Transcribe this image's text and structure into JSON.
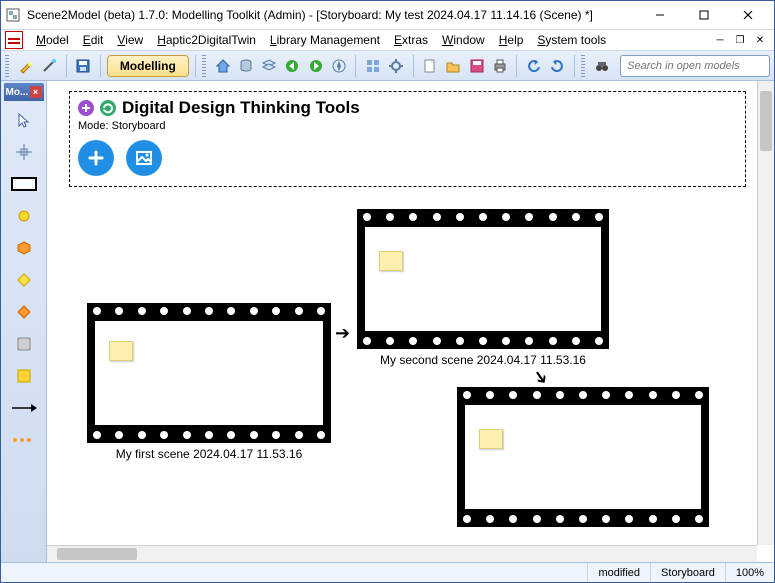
{
  "window": {
    "title": "Scene2Model (beta) 1.7.0: Modelling Toolkit (Admin) - [Storyboard: My test 2024.04.17 11.14.16 (Scene) *]"
  },
  "menu": {
    "items": [
      "Model",
      "Edit",
      "View",
      "Haptic2DigitalTwin",
      "Library Management",
      "Extras",
      "Window",
      "Help",
      "System tools"
    ]
  },
  "mode_pill": "Modelling",
  "search": {
    "placeholder": "Search in open models"
  },
  "palette": {
    "title": "Mo..."
  },
  "header": {
    "title": "Digital Design Thinking Tools",
    "mode_label": "Mode: Storyboard"
  },
  "scenes": [
    {
      "label": "My first scene 2024.04.17 11.53.16"
    },
    {
      "label": "My second scene 2024.04.17 11.53.16"
    }
  ],
  "status": {
    "modified": "modified",
    "view": "Storyboard",
    "zoom": "100%"
  }
}
